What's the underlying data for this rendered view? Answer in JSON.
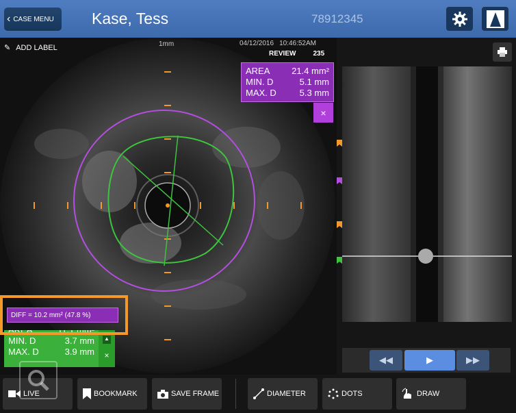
{
  "header": {
    "case_menu_label": "CASE MENU",
    "patient_name": "Kase, Tess",
    "patient_id": "78912345",
    "settings_icon": "gear-icon",
    "logo_icon": "brand-logo-icon"
  },
  "image_view": {
    "add_label": "ADD LABEL",
    "scale": "1mm",
    "date": "04/12/2016",
    "time": "10:46:52AM",
    "mode": "REVIEW",
    "frame": "235"
  },
  "measurement_purple": {
    "rows": [
      {
        "label": "AREA",
        "value": "21.4 mm²"
      },
      {
        "label": "MIN. D",
        "value": "5.1 mm"
      },
      {
        "label": "MAX. D",
        "value": "5.3 mm"
      }
    ],
    "close_label": "×",
    "color": "#8a2fb5"
  },
  "measurement_green": {
    "rows": [
      {
        "label": "AREA",
        "value": "11.1 mm²"
      },
      {
        "label": "MIN. D",
        "value": "3.7 mm"
      },
      {
        "label": "MAX. D",
        "value": "3.9 mm"
      }
    ],
    "close_label": "×",
    "color": "#3bb13b"
  },
  "diff": {
    "text": "DIFF = 10.2 mm² (47.8 %)",
    "highlight_color": "#f2992a"
  },
  "playback": {
    "rewind_icon": "rewind-icon",
    "play_icon": "play-icon",
    "forward_icon": "fast-forward-icon"
  },
  "toolbar": {
    "live": "LIVE",
    "bookmark": "BOOKMARK",
    "save_frame": "SAVE FRAME",
    "diameter": "DIAMETER",
    "dots": "DOTS",
    "draw": "DRAW"
  }
}
